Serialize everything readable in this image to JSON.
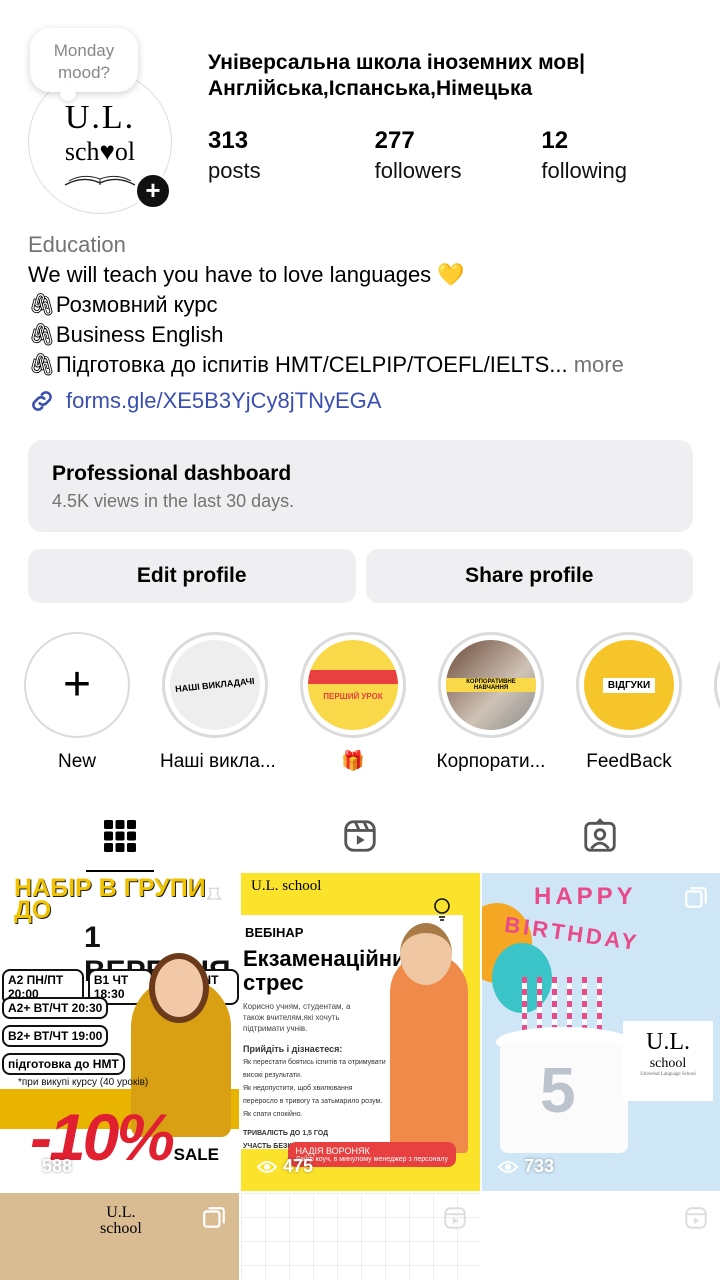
{
  "profile": {
    "note": "Monday mood?",
    "logo_ul": "U.L.",
    "logo_school": "sch♥ol",
    "name_line1": "Універсальна школа іноземних мов|",
    "name_line2": "Англійська,Іспанська,Німецька"
  },
  "stats": [
    {
      "value": "313",
      "label": "posts"
    },
    {
      "value": "277",
      "label": "followers"
    },
    {
      "value": "12",
      "label": "following"
    }
  ],
  "bio": {
    "category": "Education",
    "line1": "We will teach you have to love languages 💛",
    "line2": "🖇Розмовний курс",
    "line3": "🖇Business English",
    "line4": "🖇Підготовка до іспитів НМТ/CELPIP/TOEFL/IELTS...",
    "more": "more",
    "link": "forms.gle/XE5B3YjCy8jTNyEGA"
  },
  "dashboard": {
    "title": "Professional dashboard",
    "subtitle": "4.5K views in the last 30 days."
  },
  "buttons": {
    "edit": "Edit profile",
    "share": "Share profile"
  },
  "highlights": [
    {
      "label": "New"
    },
    {
      "label": "Наші викла...",
      "cover_text": "НАШІ ВИКЛАДАЧІ"
    },
    {
      "label": "🎁",
      "cover_text": "ПЕРШИЙ УРОК"
    },
    {
      "label": "Корпорати...",
      "cover_text": "КОРПОРАТИВНЕ НАВЧАННЯ"
    },
    {
      "label": "FeedBack",
      "cover_text": "ВІДГУКИ"
    }
  ],
  "posts": [
    {
      "title1": "НАБІР В ГРУПИ ДО",
      "title2": "1 ВЕРЕСНЯ",
      "rows": [
        [
          "A2 ПН/ПТ 20:00",
          "B1 ЧТ 18:30",
          "B1 ПН/ЧТ 20:00"
        ],
        [
          "A2+ ВТ/ЧТ 20:30"
        ],
        [
          "B2+ ВТ/ЧТ 19:00"
        ],
        [
          "підготовка до НМТ"
        ]
      ],
      "note": "*при викупі курсу (40 уроків)",
      "discount": "-10%",
      "sale": "SALE",
      "views": "588"
    },
    {
      "logo": "U.L. school",
      "tag": "ВЕБІНАР",
      "title": "Екзаменаційний стрес",
      "text": "Корисно учням, студентам, а також вчителям,які хочуть підтримати учнів.",
      "list_head": "Прийдіть і дізнаєтеся:",
      "list": [
        "Як перестати боятись іспитів та отримувати високі результати.",
        "Як недопустити, щоб хвилювання переросло в тривогу та затьмарило розум.",
        "Як спати спокійно."
      ],
      "duration": "ТРИВАЛІСТЬ ДО 1,5 ГОД",
      "free": "УЧАСТЬ БЕЗКОШТОВНА",
      "speaker": "НАДІЯ ВОРОНЯК",
      "speaker_role": "Лайф коуч, в минулому менеджер з персоналу",
      "views": "475"
    },
    {
      "happy": "HAPPY",
      "birthday": "BIRTHDAY",
      "number": "5",
      "logo_ul": "U.L.",
      "logo_school": "school",
      "logo_tagline": "Universal Language School",
      "views": "733"
    },
    {
      "logo_ul": "U.L.",
      "logo_school": "school"
    },
    {},
    {}
  ],
  "colors": {
    "accent_link": "#3a4fb0",
    "muted": "#737373",
    "button_bg": "#efeff1",
    "yellow": "#fbe32b"
  }
}
